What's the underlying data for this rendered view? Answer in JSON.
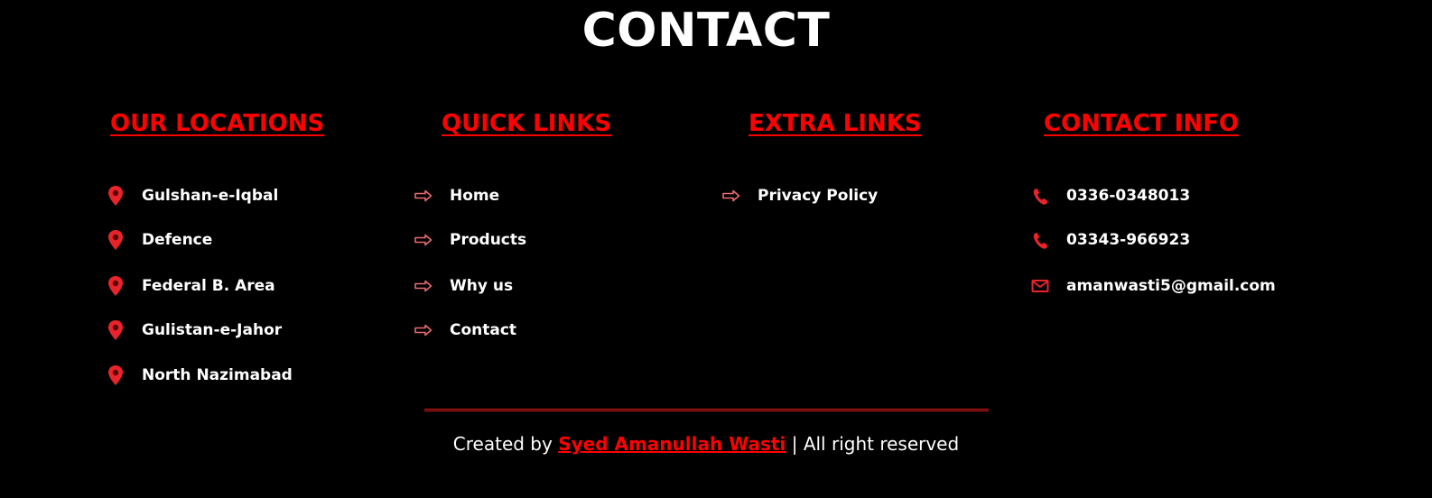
{
  "page": {
    "title": "CONTACT"
  },
  "columns": {
    "locations": {
      "heading": "OUR LOCATIONS",
      "icon": "map-pin-icon",
      "items": [
        {
          "label": "Gulshan-e-Iqbal"
        },
        {
          "label": "Defence"
        },
        {
          "label": "Federal B. Area"
        },
        {
          "label": "Gulistan-e-Jahor"
        },
        {
          "label": "North Nazimabad"
        }
      ]
    },
    "quick_links": {
      "heading": "QUICK LINKS",
      "icon": "arrow-right-icon",
      "items": [
        {
          "label": "Home"
        },
        {
          "label": "Products"
        },
        {
          "label": "Why us"
        },
        {
          "label": "Contact"
        }
      ]
    },
    "extra_links": {
      "heading": "EXTRA LINKS",
      "icon": "arrow-right-icon",
      "items": [
        {
          "label": "Privacy Policy"
        }
      ]
    },
    "contact_info": {
      "heading": "CONTACT INFO",
      "items": [
        {
          "label": "0336-0348013",
          "icon": "phone-icon"
        },
        {
          "label": "03343-966923",
          "icon": "phone-icon"
        },
        {
          "label": "amanwasti5@gmail.com",
          "icon": "envelope-icon"
        }
      ]
    }
  },
  "footer": {
    "prefix": "Created by ",
    "author": "Syed Amanullah Wasti",
    "suffix": " | All right reserved"
  },
  "colors": {
    "accent": "#ff0000",
    "background": "#000000",
    "text": "#ffffff"
  }
}
